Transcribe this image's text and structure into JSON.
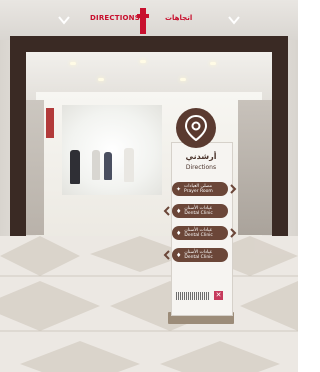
{
  "header": {
    "left_text": "DIRECTIONS",
    "right_text": "اتجاهات"
  },
  "sign": {
    "title_ar": "أرشدني",
    "title_en": "Directions",
    "rows": [
      {
        "label_ar": "مصلى العيادات",
        "label_en": "Prayer Room",
        "arrow": "right",
        "icon": "prayer-icon"
      },
      {
        "label_ar": "عيادات الأسنان",
        "label_en": "Dental Clinic",
        "arrow": "left",
        "icon": "tooth-icon"
      },
      {
        "label_ar": "عيادات الأسنان",
        "label_en": "Dental Clinic",
        "arrow": "right",
        "icon": "tooth-icon"
      },
      {
        "label_ar": "عيادات الأسنان",
        "label_en": "Dental Clinic",
        "arrow": "left",
        "icon": "tooth-icon"
      }
    ]
  },
  "colors": {
    "sign_brown": "#6b4638",
    "sign_dark": "#5a3a30",
    "header_red": "#c8102e",
    "frame": "#3a2a24"
  }
}
